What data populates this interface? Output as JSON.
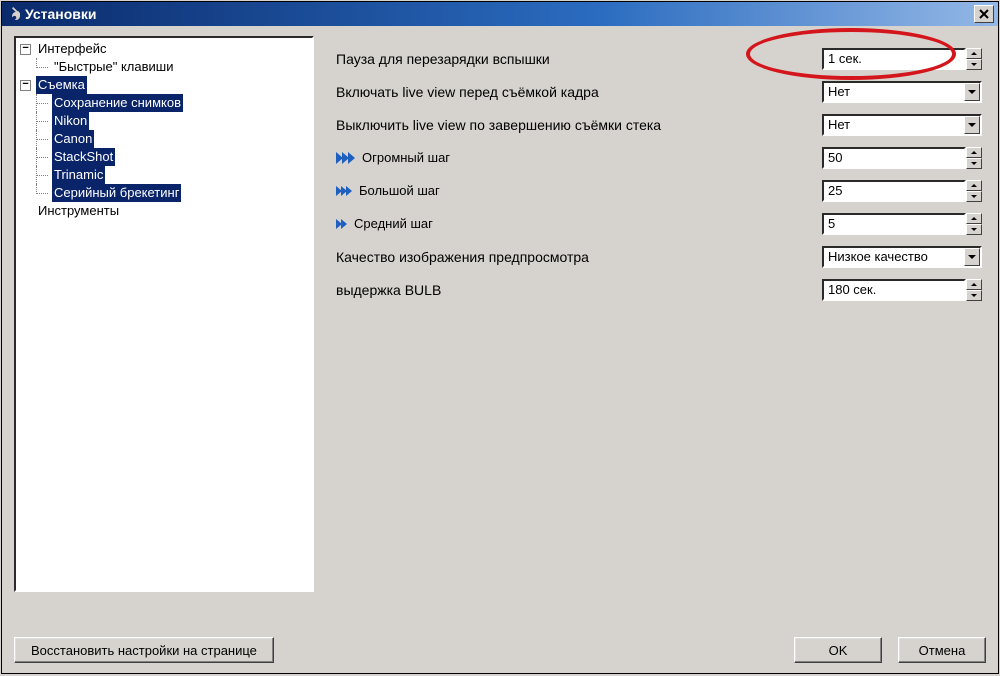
{
  "window": {
    "title": "Установки"
  },
  "tree": {
    "interface": {
      "label": "Интерфейс",
      "hotkeys": "\"Быстрые\" клавиши"
    },
    "capture": {
      "label": "Съемка",
      "save": "Сохранение снимков",
      "nikon": "Nikon",
      "canon": "Canon",
      "stackshot": "StackShot",
      "trinamic": "Trinamic",
      "serial_bracket": "Серийный брекетинг"
    },
    "tools": "Инструменты"
  },
  "settings": {
    "flash_pause": {
      "label": "Пауза для перезарядки вспышки",
      "value": "1 сек."
    },
    "enable_liveview": {
      "label": "Включать live view перед съёмкой кадра",
      "value": "Нет"
    },
    "disable_liveview": {
      "label": "Выключить live view по завершению съёмки стека",
      "value": "Нет"
    },
    "huge_step": {
      "label": "Огромный шаг",
      "value": "50"
    },
    "big_step": {
      "label": "Большой шаг",
      "value": "25"
    },
    "medium_step": {
      "label": "Средний шаг",
      "value": "5"
    },
    "preview_quality": {
      "label": "Качество изображения предпросмотра",
      "value": "Низкое качество"
    },
    "bulb": {
      "label": "выдержка BULB",
      "value": "180 сек."
    }
  },
  "footer": {
    "restore": "Восстановить настройки на странице",
    "ok": "OK",
    "cancel": "Отмена"
  }
}
